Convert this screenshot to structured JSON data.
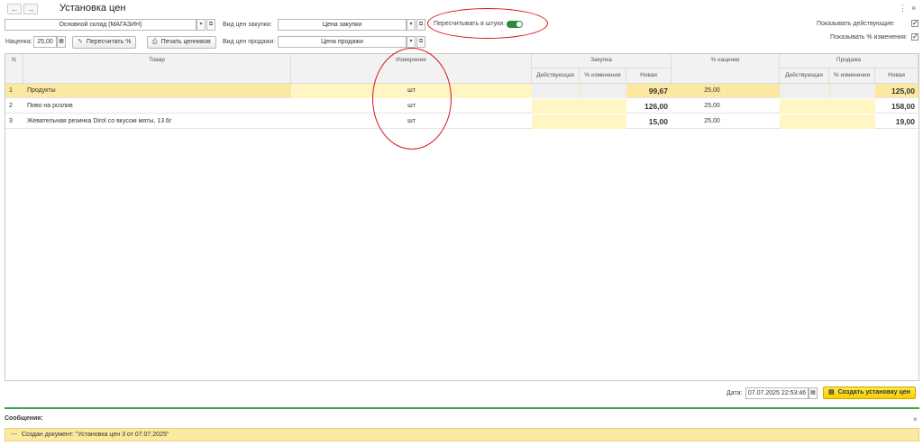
{
  "window": {
    "title": "Установка цен",
    "back_glyph": "←",
    "forward_glyph": "→",
    "more_glyph": "⋮",
    "close_glyph": "×"
  },
  "form": {
    "warehouse": "Основной склад (МАГАЗИН)",
    "purchase_price_type_label": "Вид цен закупки:",
    "purchase_price_type": "Цена закупки",
    "sale_price_type_label": "Вид цен продажи:",
    "sale_price_type": "Цена продажи",
    "recalc_pieces_label": "Пересчитывать в штуки:",
    "recalc_pieces_on": true,
    "markup_label": "Наценка:",
    "markup_value": "25,00",
    "recalc_button": "Пересчитать %",
    "print_button": "Печать ценников",
    "show_current_label": "Показывать действующие:",
    "show_change_label": "Показывать % изменения:",
    "show_current_checked": true,
    "show_change_checked": true
  },
  "table": {
    "headers": {
      "n": "N",
      "product": "Товар",
      "unit": "Измерение",
      "purchase_group": "Закупка",
      "purchase_current": "Действующая",
      "purchase_change": "% изменения",
      "purchase_new": "Новая",
      "markup_pct": "% наценки",
      "sale_group": "Продажа",
      "sale_current": "Действующая",
      "sale_change": "% изменения",
      "sale_new": "Новая"
    },
    "rows": [
      {
        "n": "1",
        "product": "Продукты",
        "unit": "шт",
        "purchase_new": "99,67",
        "markup": "25,00",
        "sale_new": "125,00"
      },
      {
        "n": "2",
        "product": "Пиво на розлив",
        "unit": "шт",
        "purchase_new": "126,00",
        "markup": "25,00",
        "sale_new": "158,00"
      },
      {
        "n": "3",
        "product": "Жевательная резинка Dirol со вкусом мяты, 13.6г",
        "unit": "шт",
        "purchase_new": "15,00",
        "markup": "25,00",
        "sale_new": "19,00"
      }
    ]
  },
  "bottom": {
    "date_label": "Дата:",
    "date_value": "07.07.2025 22:53:46",
    "create_button": "Создать установку цен"
  },
  "messages": {
    "title": "Сообщения:",
    "text": "Создан документ: \"Установка цен 3 от 07.07.2025\"",
    "close_glyph": "×",
    "bullet": "—"
  },
  "colors": {
    "accent_green": "#2e8b3e",
    "highlight_red": "#d6141b",
    "selected_row": "#fbe9a2",
    "primary_button": "#f6cf00"
  }
}
